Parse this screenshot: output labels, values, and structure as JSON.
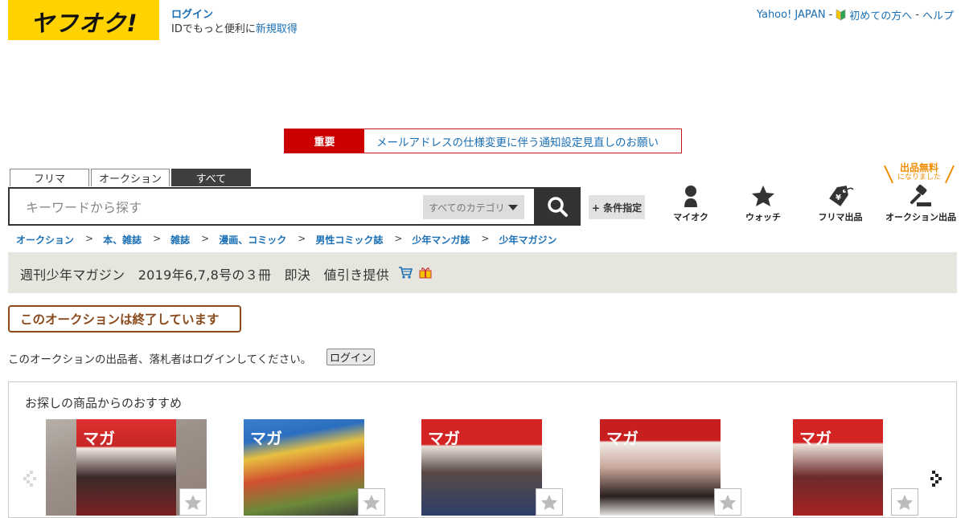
{
  "header": {
    "logo_text": "ヤフオク!",
    "login_label": "ログイン",
    "login_hint_prefix": "IDでもっと便利に",
    "signup_label": "新規取得",
    "yahoo_japan_label": "Yahoo! JAPAN",
    "separator": "-",
    "beginners_label": "初めての方へ",
    "help_label": "ヘルプ"
  },
  "notice": {
    "tag": "重要",
    "text": "メールアドレスの仕様変更に伴う通知設定見直しのお願い"
  },
  "search": {
    "tabs": [
      {
        "label": "フリマ",
        "active": false
      },
      {
        "label": "オークション",
        "active": false
      },
      {
        "label": "すべて",
        "active": true
      }
    ],
    "placeholder": "キーワードから探す",
    "category_label": "すべてのカテゴリ",
    "search_icon": "search-icon",
    "conditions_label": "+ 条件指定"
  },
  "nav": {
    "items": [
      {
        "label": "マイオク",
        "icon": "person-icon"
      },
      {
        "label": "ウォッチ",
        "icon": "star-icon"
      },
      {
        "label": "フリマ出品",
        "icon": "price-tag-icon"
      },
      {
        "label": "オークション出品",
        "icon": "gavel-icon"
      }
    ],
    "free_listing_line1": "出品無料",
    "free_listing_line2": "になりました",
    "accent_color": "#f08c00"
  },
  "breadcrumb": {
    "items": [
      "オークション",
      "本、雑誌",
      "雑誌",
      "漫画、コミック",
      "男性コミック誌",
      "少年マンガ誌",
      "少年マガジン"
    ],
    "separator": ">"
  },
  "item": {
    "title": "週刊少年マガジン　2019年6,7,8号の３冊　即決　値引き提供",
    "icons": [
      "cart-icon",
      "gift-icon"
    ]
  },
  "status": {
    "ended_text": "このオークションは終了しています",
    "login_notice": "このオークションの出品者、落札者はログインしてください。",
    "login_button": "ログイン",
    "accent_color": "#8a4b1e"
  },
  "recommendations": {
    "title": "お探しの商品からのおすすめ",
    "items": [
      {
        "cover_text": "マガ",
        "color": "#d42323"
      },
      {
        "cover_text": "マガ",
        "color": "#2a6ec0"
      },
      {
        "cover_text": "マガ",
        "color": "#d42323"
      },
      {
        "cover_text": "マガ",
        "color": "#c71f1f"
      },
      {
        "cover_text": "マガ",
        "color": "#d42323"
      }
    ]
  },
  "colors": {
    "brand_yellow": "#ffd200",
    "link_blue": "#1a6fb5",
    "notice_red": "#cc0000"
  }
}
